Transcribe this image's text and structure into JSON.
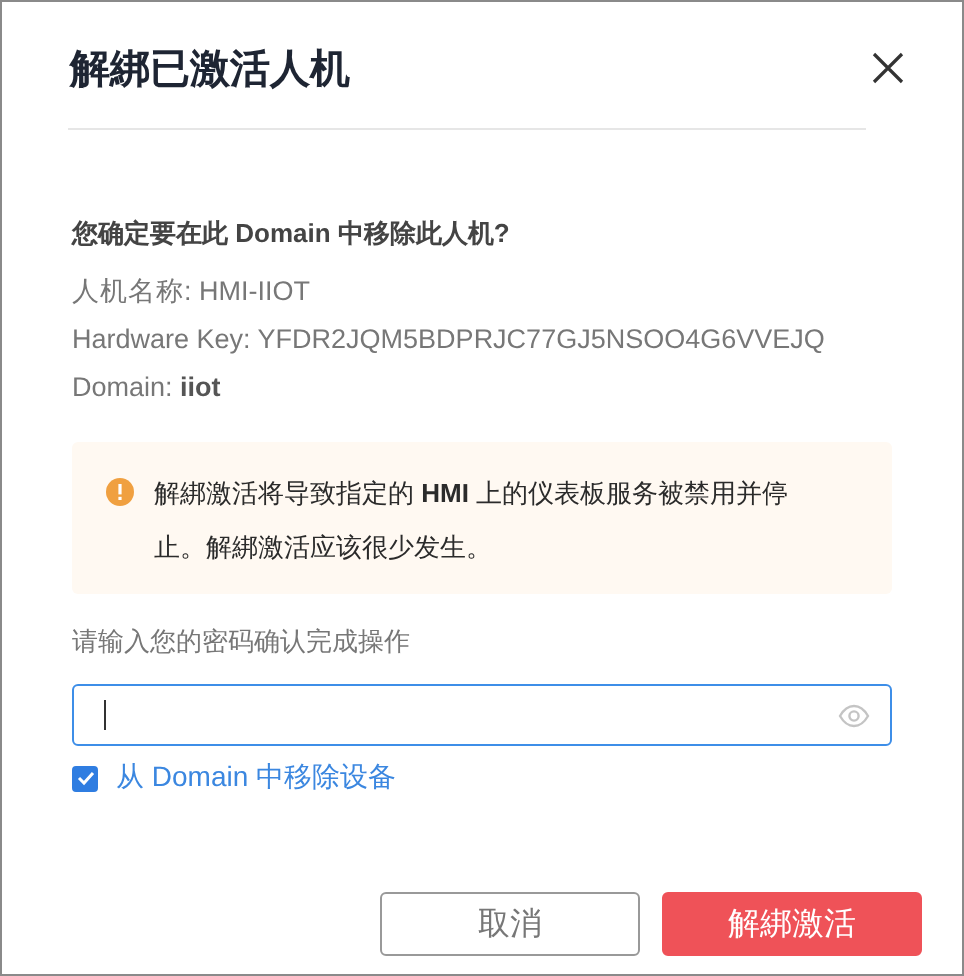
{
  "dialog": {
    "title": "解綁已激活人机",
    "question": "您确定要在此 Domain 中移除此人机?",
    "details": [
      "人机名称: HMI-IIOT",
      "Hardware Key: YFDR2JQM5BDPRJC77GJ5NSOO4G6VVEJQ",
      "Domain: **iiot**"
    ],
    "warning": "解綁激活将导致指定的 **HMI** 上的仪表板服务被禁用并停止。解綁激活应该很少发生。",
    "password": {
      "label": "请输入您的密码确认完成操作",
      "focused": true
    },
    "remove_from_domain": {
      "label": "从 Domain 中移除设备",
      "checked": true
    },
    "buttons": [
      {
        "label": "取消",
        "kind": "secondary"
      },
      {
        "label": "解綁激活",
        "kind": "danger"
      }
    ]
  }
}
